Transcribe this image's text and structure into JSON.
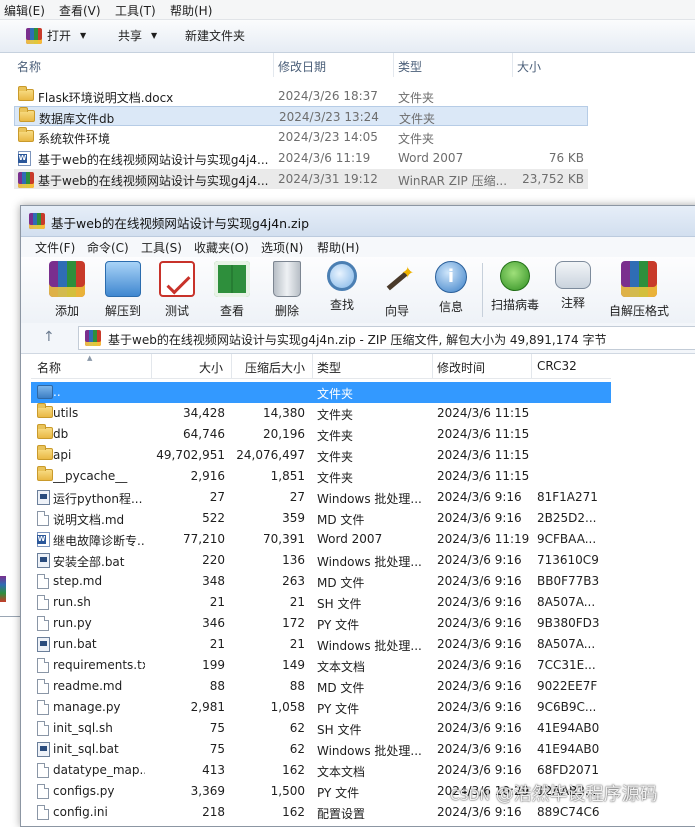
{
  "explorer": {
    "menu": [
      "编辑(E)",
      "查看(V)",
      "工具(T)",
      "帮助(H)"
    ],
    "toolbar": {
      "open": "打开",
      "share": "共享",
      "new_folder": "新建文件夹"
    },
    "columns": {
      "name": "名称",
      "date": "修改日期",
      "type": "类型",
      "size": "大小"
    },
    "files": [
      {
        "name": "Flask环境说明文档.docx",
        "date": "2024/3/26 18:37",
        "type": "文件夹",
        "size": "",
        "icon": "folder-icon"
      },
      {
        "name": "数据库文件db",
        "date": "2024/3/23 13:24",
        "type": "文件夹",
        "size": "",
        "icon": "folder-icon"
      },
      {
        "name": "系统软件环境",
        "date": "2024/3/23 14:05",
        "type": "文件夹",
        "size": "",
        "icon": "folder-icon"
      },
      {
        "name": "基于web的在线视频网站设计与实现g4j4...",
        "date": "2024/3/6 11:19",
        "type": "Word 2007",
        "size": "76 KB",
        "icon": "word-doc-icon"
      },
      {
        "name": "基于web的在线视频网站设计与实现g4j4...",
        "date": "2024/3/31 19:12",
        "type": "WinRAR ZIP 压缩...",
        "size": "23,752 KB",
        "icon": "winrar-icon"
      }
    ]
  },
  "winrar": {
    "title": "基于web的在线视频网站设计与实现g4j4n.zip",
    "menu": [
      "文件(F)",
      "命令(C)",
      "工具(S)",
      "收藏夹(O)",
      "选项(N)",
      "帮助(H)"
    ],
    "tools": [
      {
        "label": "添加",
        "icon": "add-archive-icon"
      },
      {
        "label": "解压到",
        "icon": "extract-to-icon"
      },
      {
        "label": "测试",
        "icon": "test-icon"
      },
      {
        "label": "查看",
        "icon": "view-book-icon"
      },
      {
        "label": "删除",
        "icon": "delete-bin-icon"
      },
      {
        "label": "查找",
        "icon": "find-magnifier-icon"
      },
      {
        "label": "向导",
        "icon": "wizard-wand-icon"
      },
      {
        "label": "信息",
        "icon": "info-icon"
      },
      {
        "label": "扫描病毒",
        "icon": "virus-scan-icon"
      },
      {
        "label": "注释",
        "icon": "comment-icon"
      },
      {
        "label": "自解压格式",
        "icon": "sfx-icon"
      }
    ],
    "path": "基于web的在线视频网站设计与实现g4j4n.zip - ZIP 压缩文件, 解包大小为 49,891,174 字节",
    "columns": {
      "name": "名称",
      "size": "大小",
      "packed": "压缩后大小",
      "type": "类型",
      "modified": "修改时间",
      "crc": "CRC32"
    },
    "rows": [
      {
        "name": "..",
        "size": "",
        "packed": "",
        "type": "文件夹",
        "modified": "",
        "crc": "",
        "icon": "parent-folder-icon",
        "selected": true
      },
      {
        "name": "utils",
        "size": "34,428",
        "packed": "14,380",
        "type": "文件夹",
        "modified": "2024/3/6 11:15",
        "crc": "",
        "icon": "folder-icon"
      },
      {
        "name": "db",
        "size": "64,746",
        "packed": "20,196",
        "type": "文件夹",
        "modified": "2024/3/6 11:15",
        "crc": "",
        "icon": "folder-icon"
      },
      {
        "name": "api",
        "size": "49,702,951",
        "packed": "24,076,497",
        "type": "文件夹",
        "modified": "2024/3/6 11:15",
        "crc": "",
        "icon": "folder-icon"
      },
      {
        "name": "__pycache__",
        "size": "2,916",
        "packed": "1,851",
        "type": "文件夹",
        "modified": "2024/3/6 11:15",
        "crc": "",
        "icon": "folder-icon"
      },
      {
        "name": "运行python程...",
        "size": "27",
        "packed": "27",
        "type": "Windows 批处理...",
        "modified": "2024/3/6 9:16",
        "crc": "81F1A271",
        "icon": "batch-file-icon"
      },
      {
        "name": "说明文档.md",
        "size": "522",
        "packed": "359",
        "type": "MD 文件",
        "modified": "2024/3/6 9:16",
        "crc": "2B25D2...",
        "icon": "file-icon"
      },
      {
        "name": "继电故障诊断专...",
        "size": "77,210",
        "packed": "70,391",
        "type": "Word 2007",
        "modified": "2024/3/6 11:19",
        "crc": "9CFBAA...",
        "icon": "word-doc-icon"
      },
      {
        "name": "安装全部.bat",
        "size": "220",
        "packed": "136",
        "type": "Windows 批处理...",
        "modified": "2024/3/6 9:16",
        "crc": "713610C9",
        "icon": "batch-file-icon"
      },
      {
        "name": "step.md",
        "size": "348",
        "packed": "263",
        "type": "MD 文件",
        "modified": "2024/3/6 9:16",
        "crc": "BB0F77B3",
        "icon": "file-icon"
      },
      {
        "name": "run.sh",
        "size": "21",
        "packed": "21",
        "type": "SH 文件",
        "modified": "2024/3/6 9:16",
        "crc": "8A507A...",
        "icon": "file-icon"
      },
      {
        "name": "run.py",
        "size": "346",
        "packed": "172",
        "type": "PY 文件",
        "modified": "2024/3/6 9:16",
        "crc": "9B380FD3",
        "icon": "file-icon"
      },
      {
        "name": "run.bat",
        "size": "21",
        "packed": "21",
        "type": "Windows 批处理...",
        "modified": "2024/3/6 9:16",
        "crc": "8A507A...",
        "icon": "batch-file-icon"
      },
      {
        "name": "requirements.txt",
        "size": "199",
        "packed": "149",
        "type": "文本文档",
        "modified": "2024/3/6 9:16",
        "crc": "7CC31E...",
        "icon": "file-icon"
      },
      {
        "name": "readme.md",
        "size": "88",
        "packed": "88",
        "type": "MD 文件",
        "modified": "2024/3/6 9:16",
        "crc": "9022EE7F",
        "icon": "file-icon"
      },
      {
        "name": "manage.py",
        "size": "2,981",
        "packed": "1,058",
        "type": "PY 文件",
        "modified": "2024/3/6 9:16",
        "crc": "9C6B9C...",
        "icon": "file-icon"
      },
      {
        "name": "init_sql.sh",
        "size": "75",
        "packed": "62",
        "type": "SH 文件",
        "modified": "2024/3/6 9:16",
        "crc": "41E94AB0",
        "icon": "file-icon"
      },
      {
        "name": "init_sql.bat",
        "size": "75",
        "packed": "62",
        "type": "Windows 批处理...",
        "modified": "2024/3/6 9:16",
        "crc": "41E94AB0",
        "icon": "batch-file-icon"
      },
      {
        "name": "datatype_map...",
        "size": "413",
        "packed": "162",
        "type": "文本文档",
        "modified": "2024/3/6 9:16",
        "crc": "68FD2071",
        "icon": "file-icon"
      },
      {
        "name": "configs.py",
        "size": "3,369",
        "packed": "1,500",
        "type": "PY 文件",
        "modified": "2024/3/6 10:29",
        "crc": "12AAB3...",
        "icon": "file-icon"
      },
      {
        "name": "config.ini",
        "size": "218",
        "packed": "162",
        "type": "配置设置",
        "modified": "2024/3/6 9:16",
        "crc": "889C74C6",
        "icon": "file-icon"
      }
    ]
  },
  "watermark": {
    "csdn": "CSDN",
    "text": "@浩然毕设程序源码"
  }
}
